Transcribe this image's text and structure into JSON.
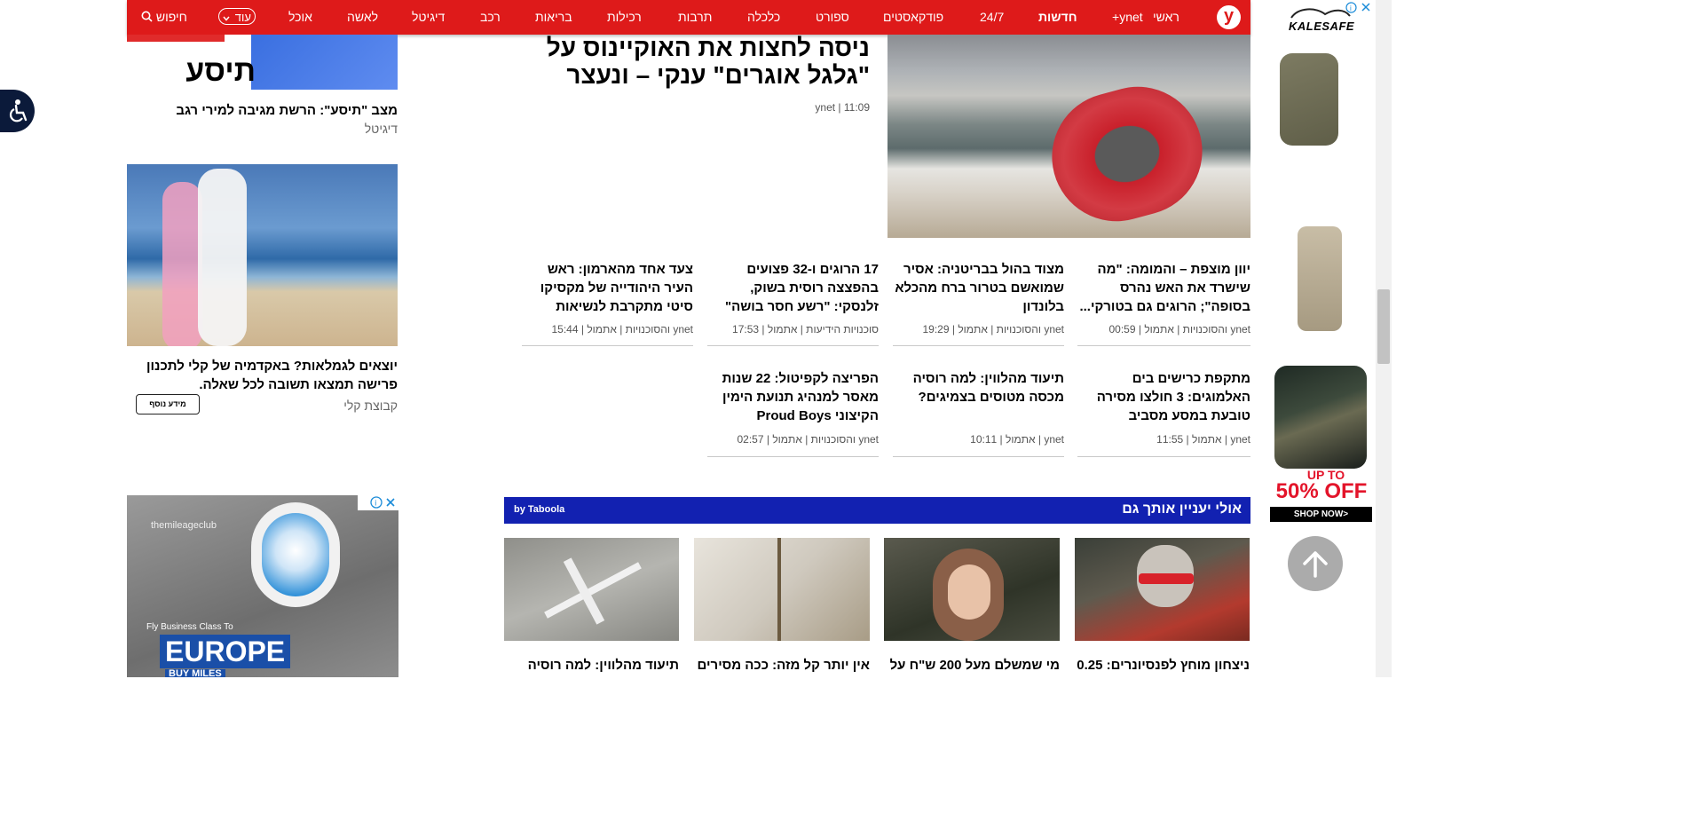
{
  "nav": {
    "logo": "y",
    "items": [
      "ראשי",
      "ynet+",
      "חדשות",
      "24/7",
      "פודקאסטים",
      "ספורט",
      "כלכלה",
      "תרבות",
      "רכילות",
      "בריאות",
      "רכב",
      "דיגיטל",
      "לאשה",
      "אוכל"
    ],
    "more": "עוד",
    "search": "חיפוש"
  },
  "left_column": {
    "top_ad_text": "תיסע",
    "top_headline": "מצב \"תיסע\": הרשת מגיבה למירי רגב",
    "top_category": "דיגיטל",
    "promo_headline": "יוצאים לגמלאות? באקדמיה של קלי לתכנון פרישה תמצאו תשובה לכל שאלה.",
    "promo_source": "קבוצת קלי",
    "promo_button": "מידע נוסף",
    "ad_brand": "themileageclub",
    "ad_small": "Fly Business Class To",
    "ad_big": "EUROPE",
    "ad_sub": "BUY MILES"
  },
  "main_story": {
    "title": "ניסה לחצות את האוקיינוס על \"גלגל אוגרים\" ענקי – ונעצר",
    "meta": "ynet | 11:09"
  },
  "articles_row1": [
    {
      "title": "יוון מוצפת – והמומה: \"מה שישרד את האש נהרס בסופה\"; הרוגים גם בטורקי...",
      "meta": "ynet והסוכנויות | אתמול | 00:59"
    },
    {
      "title": "מצוד בהול בבריטניה: אסיר שמואשם בטרור ברח מהכלא בלונדון",
      "meta": "ynet והסוכנויות | אתמול | 19:29"
    },
    {
      "title": "17 הרוגים ו-32 פצועים בהפצצה רוסית בשוק, זלנסקי: \"רשע חסר בושה\" |...",
      "meta": "סוכנויות הידיעות | אתמול | 17:53"
    },
    {
      "title": "צעד אחד מהארמון: ראש העיר היהודייה של מקסיקו סיטי מתקרבת לנשיאות",
      "meta": "ynet והסוכנויות | אתמול | 15:44"
    }
  ],
  "articles_row2": [
    {
      "title": "מתקפת כרישים בים האלמוגים: 3 חולצו מסירה טובעת במסע מסביב לעולם...",
      "meta": "ynet | אתמול | 11:55"
    },
    {
      "title": "תיעוד מהלווין: למה רוסיה מכסה מטוסים בצמיגים?",
      "meta": "ynet | אתמול | 10:11"
    },
    {
      "title": "הפריצה לקפיטול: 22 שנות מאסר למנהיג תנועת הימין הקיצוני Proud Boys",
      "meta": "ynet והסוכנויות | אתמול | 02:57"
    }
  ],
  "taboola": {
    "header": "אולי יעניין אותך גם",
    "by": "by Taboola",
    "items": [
      "ניצחון מוחץ לפנסיונרים: 0.25",
      "מי שמשלם מעל 200 ש\"ח על",
      "אין יותר קל מזה: ככה מסירים",
      "תיעוד מהלווין: למה רוסיה"
    ]
  },
  "right_ad": {
    "brand": "KALESAFE",
    "promo_top": "UP TO",
    "promo_big": "50% OFF",
    "promo_btn": "SHOP NOW>"
  },
  "colors": {
    "nav_red": "#de1a1a",
    "taboola_blue": "#1221b1",
    "accessibility": "#0b1a3a"
  }
}
